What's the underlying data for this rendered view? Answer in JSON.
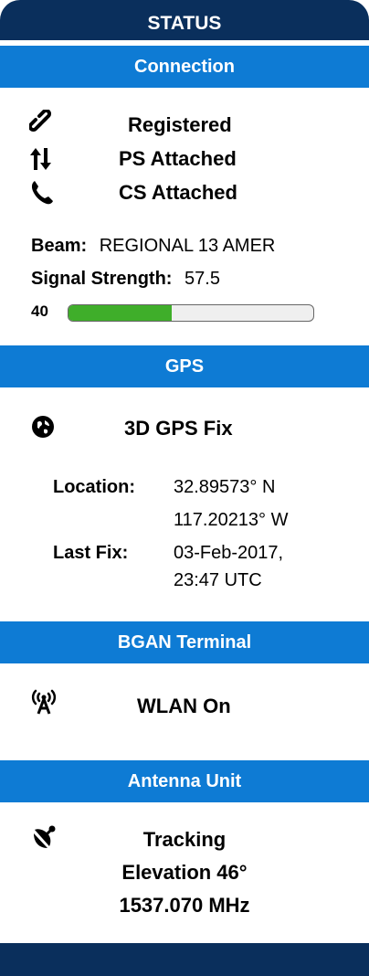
{
  "panel_title": "STATUS",
  "connection": {
    "header": "Connection",
    "items": [
      {
        "icon": "link-icon",
        "label": "Registered"
      },
      {
        "icon": "up-down-arrows-icon",
        "label": "PS Attached"
      },
      {
        "icon": "phone-icon",
        "label": "CS Attached"
      }
    ],
    "beam_label": "Beam:",
    "beam_value": "REGIONAL 13 AMER",
    "signal_label": "Signal Strength:",
    "signal_value": "57.5",
    "bar_min": "40",
    "signal_fill_fraction": 0.42
  },
  "gps": {
    "header": "GPS",
    "status": "3D GPS Fix",
    "location_label": "Location:",
    "lat": "32.89573° N",
    "lon": "117.20213° W",
    "last_fix_label": "Last Fix:",
    "last_fix_date": "03-Feb-2017,",
    "last_fix_time": "23:47 UTC"
  },
  "terminal": {
    "header": "BGAN Terminal",
    "status": "WLAN On"
  },
  "antenna": {
    "header": "Antenna Unit",
    "status": "Tracking",
    "elevation": "Elevation 46°",
    "frequency": "1537.070 MHz"
  },
  "colors": {
    "title_bg": "#0a2f5c",
    "section_bg": "#0e7bd4",
    "signal_fill": "#3fae2a"
  }
}
